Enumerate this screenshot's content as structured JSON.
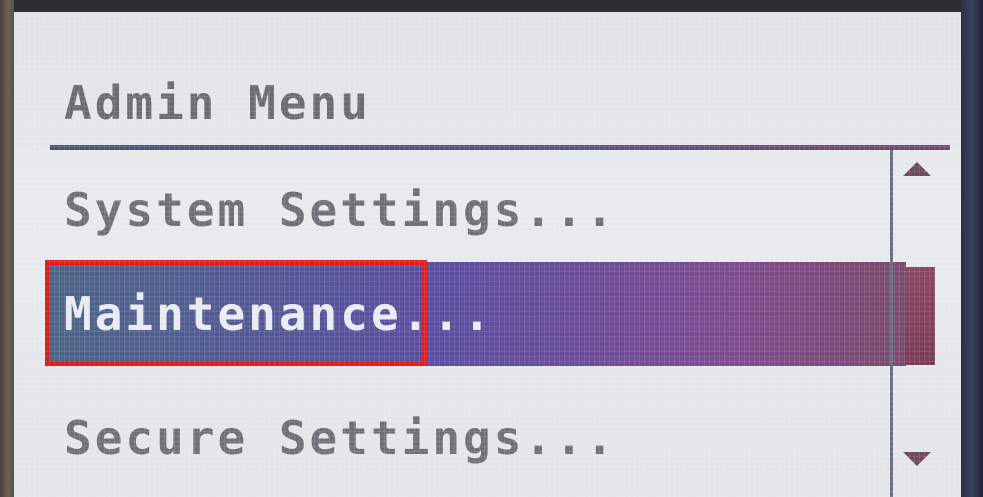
{
  "screen": {
    "title": "Admin Menu",
    "menu_items": [
      {
        "label": "System Settings..."
      },
      {
        "label": "Maintenance...",
        "selected": true
      },
      {
        "label": "Secure Settings..."
      }
    ],
    "scrollbar": {
      "up_icon": "triangle-up-icon",
      "down_icon": "triangle-down-icon",
      "position": 0.45
    },
    "colors": {
      "selection": "#5a4ea0",
      "highlight_annotation": "#e11c1c",
      "scroll_thumb": "#8a4760"
    }
  }
}
